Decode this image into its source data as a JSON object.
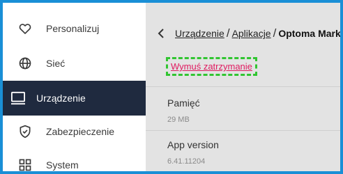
{
  "sidebar": {
    "items": [
      {
        "label": "Personalizuj",
        "icon": "heart-icon"
      },
      {
        "label": "Sieć",
        "icon": "globe-icon"
      },
      {
        "label": "Urządzenie",
        "icon": "monitor-icon"
      },
      {
        "label": "Zabezpieczenie",
        "icon": "shield-check-icon"
      },
      {
        "label": "System",
        "icon": "grid-icon"
      }
    ],
    "active_index": 2
  },
  "breadcrumb": {
    "back_icon": "chevron-left-icon",
    "items": [
      "Urządzenie",
      "Aplikacje"
    ],
    "separator": "/",
    "current": "Optoma Marketplace"
  },
  "actions": {
    "force_stop_label": "Wymuś zatrzymanie"
  },
  "details": {
    "memory_label": "Pamięć",
    "memory_value": "29 MB",
    "version_label": "App version",
    "version_value": "6.41.11204"
  },
  "colors": {
    "frame_border": "#1a8fd6",
    "active_sidebar_bg": "#1f2a3f",
    "force_stop_text": "#e0195f",
    "highlight_dash": "#31c531",
    "content_bg": "#e3e3e3"
  }
}
